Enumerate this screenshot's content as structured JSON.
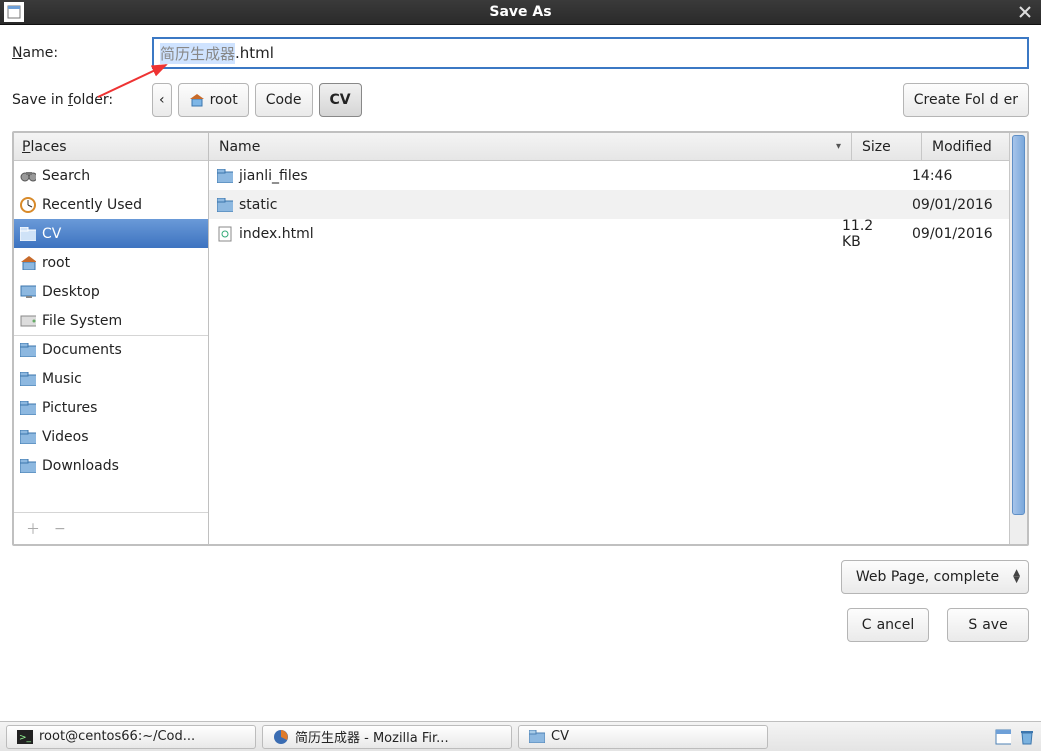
{
  "window": {
    "title": "Save As"
  },
  "labels": {
    "name_prefix": "N",
    "name_rest": "ame:",
    "folder_prefix": "Save in ",
    "folder_u": "f",
    "folder_rest": "older:",
    "create_folder": "Create Fol",
    "create_folder_u": "d",
    "create_folder_end": "er"
  },
  "name_field": {
    "selected_part": "简历生成器",
    "rest": ".html"
  },
  "breadcrumbs": {
    "back": "‹",
    "items": [
      {
        "label": "root",
        "has_home_icon": true,
        "current": false
      },
      {
        "label": "Code",
        "has_home_icon": false,
        "current": false
      },
      {
        "label": "CV",
        "has_home_icon": false,
        "current": true
      }
    ]
  },
  "places": {
    "header_prefix": "P",
    "header_rest": "laces",
    "items": [
      {
        "icon": "binoculars",
        "label": "Search",
        "selected": false,
        "sep": false
      },
      {
        "icon": "recent",
        "label": "Recently Used",
        "selected": false,
        "sep": false
      },
      {
        "icon": "folder",
        "label": "CV",
        "selected": true,
        "sep": false
      },
      {
        "icon": "home",
        "label": "root",
        "selected": false,
        "sep": false
      },
      {
        "icon": "desktop",
        "label": "Desktop",
        "selected": false,
        "sep": false
      },
      {
        "icon": "disk",
        "label": "File System",
        "selected": false,
        "sep": false
      },
      {
        "icon": "folder",
        "label": "Documents",
        "selected": false,
        "sep": true
      },
      {
        "icon": "folder",
        "label": "Music",
        "selected": false,
        "sep": false
      },
      {
        "icon": "folder",
        "label": "Pictures",
        "selected": false,
        "sep": false
      },
      {
        "icon": "folder",
        "label": "Videos",
        "selected": false,
        "sep": false
      },
      {
        "icon": "folder",
        "label": "Downloads",
        "selected": false,
        "sep": false
      }
    ]
  },
  "files": {
    "columns": {
      "name": "Name",
      "size": "Size",
      "modified": "Modified"
    },
    "rows": [
      {
        "icon": "folder",
        "name": "jianli_files",
        "size": "",
        "modified": "14:46",
        "alt": false
      },
      {
        "icon": "folder",
        "name": "static",
        "size": "",
        "modified": "09/01/2016",
        "alt": true
      },
      {
        "icon": "html",
        "name": "index.html",
        "size": "11.2 KB",
        "modified": "09/01/2016",
        "alt": false
      }
    ]
  },
  "filetype": {
    "label": "Web Page, complete"
  },
  "buttons": {
    "cancel_u": "C",
    "cancel_rest": "ancel",
    "save_u": "S",
    "save_rest": "ave"
  },
  "taskbar": {
    "items": [
      {
        "icon": "terminal",
        "label": "root@centos66:~/Cod..."
      },
      {
        "icon": "firefox",
        "label": "简历生成器 - Mozilla Fir..."
      },
      {
        "icon": "folder",
        "label": "CV"
      }
    ]
  }
}
